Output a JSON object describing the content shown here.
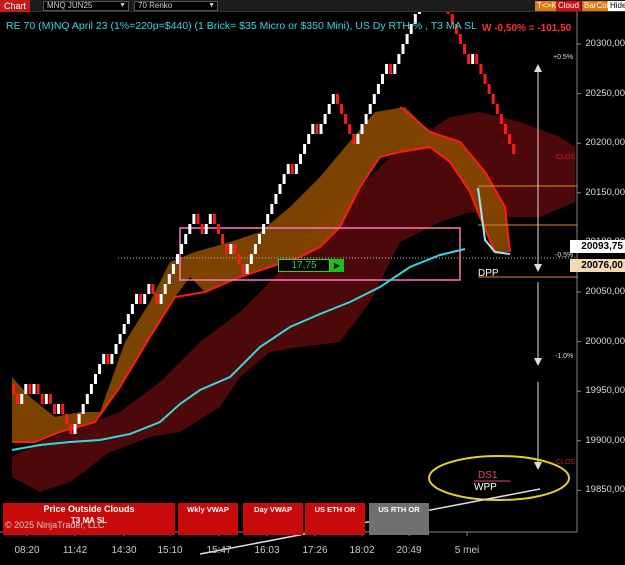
{
  "toolbar": {
    "chart_label": "Chart",
    "instrument": "MNQ JUN25",
    "bar_type": "70 Renko",
    "buttons": [
      {
        "label": "T<>K",
        "color": "#e07a10"
      },
      {
        "label": "Cloud",
        "color": "#d01010"
      },
      {
        "label": "BarCol",
        "color": "#e07a10"
      },
      {
        "label": "Hide",
        "color": "#ffffff"
      }
    ]
  },
  "chart": {
    "title": "RE 70 (M)NQ April 23 (1%=220p=$440) (1 Brick= $35 Micro or $350 Mini), US Dy RTH % , T3 MA SL",
    "pnl": "W -0,50% = -101,50",
    "price_axis": [
      {
        "label": "20300,00",
        "value": 20300
      },
      {
        "label": "20250,00",
        "value": 20250
      },
      {
        "label": "20200,00",
        "value": 20200
      },
      {
        "label": "20150,00",
        "value": 20150
      },
      {
        "label": "20100,00",
        "value": 20100
      },
      {
        "label": "20050,00",
        "value": 20050
      },
      {
        "label": "20000,00",
        "value": 20000
      },
      {
        "label": "19950,00",
        "value": 19950
      },
      {
        "label": "19900,00",
        "value": 19900
      },
      {
        "label": "19850,00",
        "value": 19850
      }
    ],
    "last_price": "20093,75",
    "dpp_price": "20076,00",
    "time_axis": [
      "08:20",
      "11:42",
      "14:30",
      "15:10",
      "15:47",
      "16:03",
      "17:26",
      "18:02",
      "20:49",
      "5 mei"
    ],
    "pct_labels": [
      "+0.5%",
      "-0.5%",
      "-1.0%"
    ],
    "red_labels": [
      "CLOS",
      "CLOS"
    ],
    "brick_count": "17,75",
    "brick_arrow": "▶",
    "dpp_label": "DPP",
    "ds1_label": "DS1",
    "wpp_label": "WPP",
    "colors": {
      "up": "#ffffff",
      "down": "#ff1a1a",
      "ma": "#36d7e0",
      "cloud": "#8a4a00",
      "band": "#5a0a0a"
    }
  },
  "panels": {
    "main_title": "Price Outside Clouds",
    "main_sub": "T3 MA SL",
    "wkly_vwap": "Wkly VWAP",
    "day_vwap": "Day VWAP",
    "us_eth_or": "US ETH OR",
    "us_rth_or": "US RTH OR"
  },
  "copyright": "© 2025 NinjaTrader, LLC"
}
